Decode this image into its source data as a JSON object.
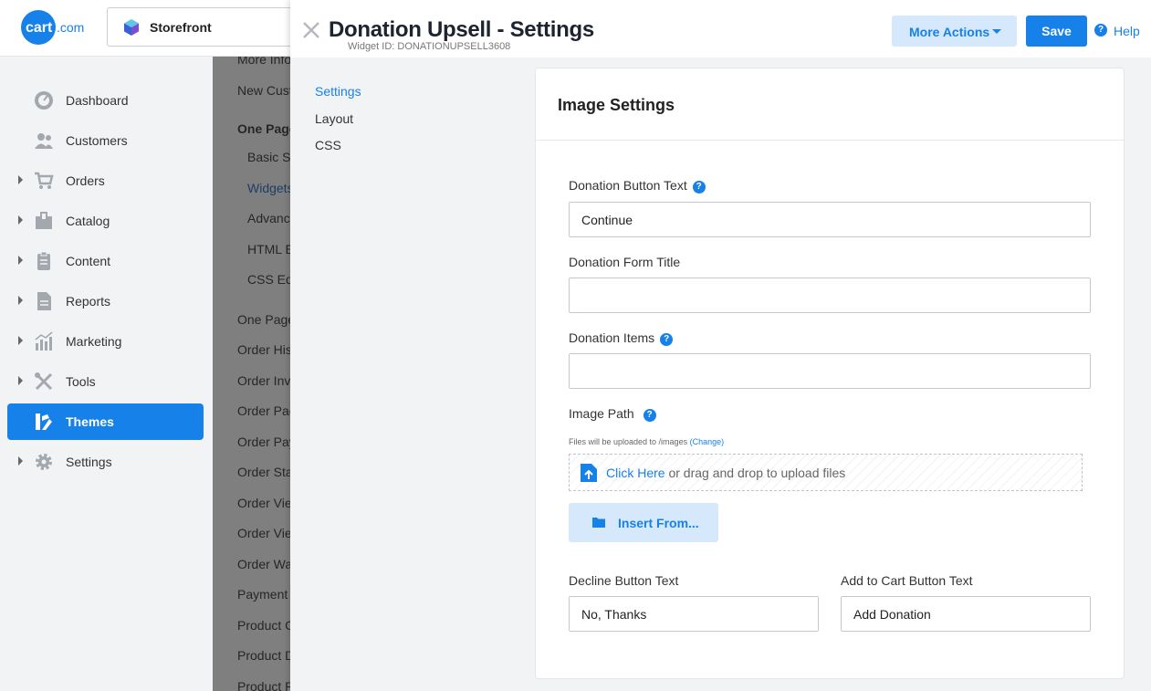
{
  "brand": {
    "logo_text": "cart.com",
    "accent": "#1681e8"
  },
  "store_selector": {
    "label": "Storefront"
  },
  "sidebar": {
    "items": [
      {
        "label": "Dashboard",
        "icon": "dashboard-icon",
        "expandable": false
      },
      {
        "label": "Customers",
        "icon": "customers-icon",
        "expandable": false
      },
      {
        "label": "Orders",
        "icon": "cart-icon",
        "expandable": true
      },
      {
        "label": "Catalog",
        "icon": "box-icon",
        "expandable": true
      },
      {
        "label": "Content",
        "icon": "clipboard-icon",
        "expandable": true
      },
      {
        "label": "Reports",
        "icon": "report-icon",
        "expandable": true
      },
      {
        "label": "Marketing",
        "icon": "chart-icon",
        "expandable": true
      },
      {
        "label": "Tools",
        "icon": "tools-icon",
        "expandable": true
      },
      {
        "label": "Themes",
        "icon": "themes-icon",
        "expandable": false,
        "active": true
      },
      {
        "label": "Settings",
        "icon": "gear-icon",
        "expandable": true
      }
    ]
  },
  "subnav": {
    "items": [
      "More Info",
      "New Cust",
      "One Page",
      "Basic Se",
      "Widgets",
      "Advanc",
      "HTML E",
      "CSS Edi",
      "One Page",
      "Order His",
      "Order Inv",
      "Order Pac",
      "Order Pay",
      "Order Sta",
      "Order Vie",
      "Order Vie",
      "Order Wa",
      "Payment",
      "Product C",
      "Product D",
      "Product R"
    ]
  },
  "modal": {
    "title": "Donation Upsell - Settings",
    "widget_id": "Widget ID: DONATIONUPSELL3608",
    "more_actions": "More Actions",
    "save": "Save",
    "help": "Help",
    "tabs": [
      "Settings",
      "Layout",
      "CSS"
    ],
    "card": {
      "title": "Image Settings",
      "donation_button_text": {
        "label": "Donation Button Text",
        "value": "Continue"
      },
      "donation_form_title": {
        "label": "Donation Form Title",
        "value": ""
      },
      "donation_items": {
        "label": "Donation Items",
        "value": ""
      },
      "image_path": {
        "label": "Image Path",
        "note": "Files will be uploaded to /images",
        "change": "(Change)",
        "click_here": "Click Here",
        "drop_text": "or drag and drop to upload files",
        "insert_from": "Insert From..."
      },
      "decline_button_text": {
        "label": "Decline Button Text",
        "value": "No, Thanks"
      },
      "add_to_cart_button_text": {
        "label": "Add to Cart Button Text",
        "value": "Add Donation"
      }
    }
  }
}
